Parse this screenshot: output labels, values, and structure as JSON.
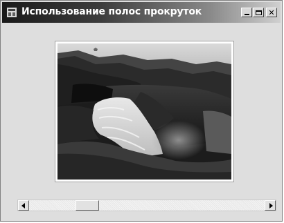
{
  "window": {
    "title": "Использование полос прокруток",
    "icon": "app-window-icon",
    "controls": {
      "minimize": "minimize-icon",
      "maximize": "maximize-icon",
      "close_glyph": "✕"
    }
  },
  "picture": {
    "subject": "waterfall-landscape-photo",
    "colors": {
      "frame": "#ffffff",
      "scene": "grayscale"
    }
  },
  "scrollbar": {
    "orientation": "horizontal",
    "left_arrow": "arrow-left-icon",
    "right_arrow": "arrow-right-icon",
    "thumb_position_fraction": 0.22
  }
}
